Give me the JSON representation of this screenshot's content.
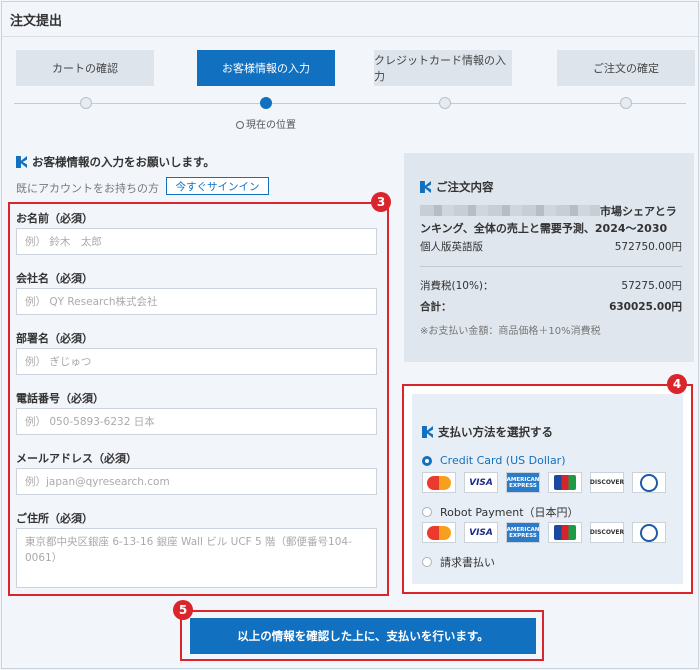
{
  "page_title": "注文提出",
  "steps": [
    {
      "label": "カートの確認",
      "active": false
    },
    {
      "label": "お客様情報の入力",
      "active": true
    },
    {
      "label": "クレジットカード情報の入力",
      "active": false
    },
    {
      "label": "ご注文の確定",
      "active": false
    }
  ],
  "current_position": "現在の位置",
  "form": {
    "heading": "お客様情報の入力をお願いします。",
    "account_text": "既にアカウントをお持ちの方",
    "signin_label": "今すぐサインイン",
    "fields": {
      "name": {
        "label": "お名前（必須）",
        "placeholder": "例） 鈴木　太郎"
      },
      "company": {
        "label": "会社名（必須）",
        "placeholder": "例） QY Research株式会社"
      },
      "department": {
        "label": "部署名（必須）",
        "placeholder": "例） ぎじゅつ"
      },
      "phone": {
        "label": "電話番号（必須）",
        "placeholder": "例） 050-5893-6232 日本"
      },
      "email": {
        "label": "メールアドレス（必須）",
        "placeholder": "例）japan@qyresearch.com"
      },
      "address": {
        "label": "ご住所（必須）",
        "placeholder": "東京都中央区銀座 6-13-16 銀座 Wall ビル UCF 5 階（郵便番号104-0061）"
      }
    }
  },
  "order": {
    "heading": "ご注文内容",
    "product_suffix": "市場シェアとランキング、全体の売上と需要予測、2024～2030",
    "edition_label": "個人版英語版",
    "edition_price": "572750.00円",
    "tax_label": "消費税(10%)：",
    "tax_value": "57275.00円",
    "total_label": "合計：",
    "total_value": "630025.00円",
    "note": "※お支払い金額：商品価格＋10%消費税"
  },
  "payment": {
    "heading": "支払い方法を選択する",
    "options": [
      {
        "label": "Credit Card (US Dollar)",
        "checked": true
      },
      {
        "label": "Robot Payment（日本円）",
        "checked": false
      },
      {
        "label": "請求書払い",
        "checked": false
      }
    ],
    "cards": {
      "visa": "VISA",
      "amex": "AMERICAN EXPRESS",
      "discover": "DISCOVER"
    },
    "accent_color": "#1170c0"
  },
  "submit_label": "以上の情報を確認した上に、支払いを行います。",
  "badges": {
    "form": "3",
    "payment": "4",
    "submit": "5"
  }
}
